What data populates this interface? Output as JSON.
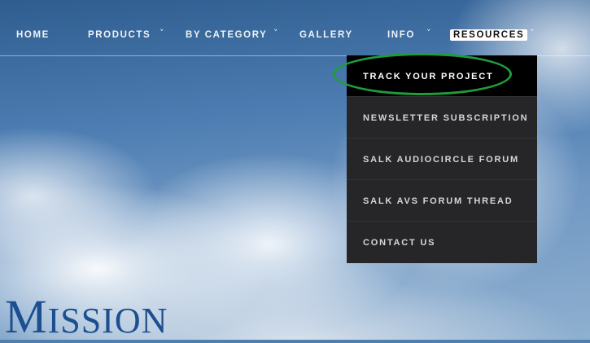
{
  "nav": {
    "items": [
      {
        "label": "HOME"
      },
      {
        "label": "PRODUCTS"
      },
      {
        "label": "BY CATEGORY"
      },
      {
        "label": "GALLERY"
      },
      {
        "label": "INFO"
      },
      {
        "label": "RESOURCES"
      }
    ],
    "chevron": "˅"
  },
  "dropdown": {
    "items": [
      {
        "label": "TRACK YOUR PROJECT"
      },
      {
        "label": "NEWSLETTER SUBSCRIPTION"
      },
      {
        "label": "SALK AUDIOCIRCLE FORUM"
      },
      {
        "label": "SALK AVS FORUM THREAD"
      },
      {
        "label": "CONTACT US"
      }
    ]
  },
  "hero": {
    "heading_first": "M",
    "heading_rest": "ISSION"
  },
  "colors": {
    "highlight_ring": "#1f9c3c",
    "heading": "#1c4f8f",
    "dropdown_bg": "#262628"
  }
}
